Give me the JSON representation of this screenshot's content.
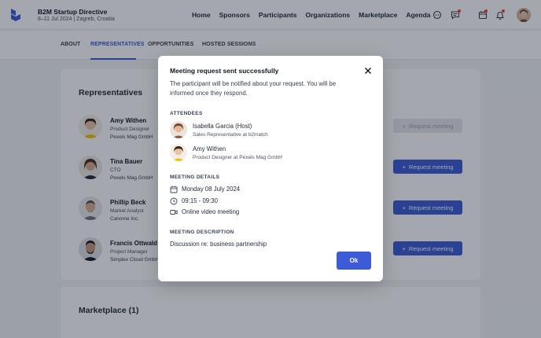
{
  "header": {
    "event_title": "B2M Startup Directive",
    "event_subtitle": "8–11 Jul 2024 | Zagreb, Croatia",
    "nav": [
      "Home",
      "Sponsors",
      "Participants",
      "Organizations",
      "Marketplace",
      "Agenda"
    ],
    "icons": [
      "chat-icon",
      "message-icon",
      "calendar-icon",
      "bell-icon"
    ],
    "accent": "#3c5bd6"
  },
  "tabs": [
    {
      "label": "ABOUT",
      "active": false
    },
    {
      "label": "REPRESENTATIVES",
      "active": true
    },
    {
      "label": "OPPORTUNITIES",
      "active": false
    },
    {
      "label": "HOSTED SESSIONS",
      "active": false
    }
  ],
  "representatives": {
    "title": "Representatives",
    "button_label": "Request meeting",
    "items": [
      {
        "name": "Amy Withen",
        "role": "Product Designer",
        "company": "Pexels Mag GmbH",
        "requested": true
      },
      {
        "name": "Tina Bauer",
        "role": "CTO",
        "company": "Pexels Mag GmbH",
        "requested": false
      },
      {
        "name": "Phillip Beck",
        "role": "Market Analyst",
        "company": "Canome Inc.",
        "requested": false
      },
      {
        "name": "Francis Ottwald",
        "role": "Project Manager",
        "company": "Simplex Cloud GmbH",
        "requested": false
      }
    ]
  },
  "marketplace": {
    "title": "Marketplace (1)"
  },
  "modal": {
    "title": "Meeting request sent successfully",
    "description": "The participant will be notified about your request. You will be informed once they respond.",
    "attendees_label": "ATTENDEES",
    "attendees": [
      {
        "name": "Isabella Garcia (Host)",
        "role": "Sales Representative at b2match"
      },
      {
        "name": "Amy Withen",
        "role": "Product Designer at Pexels Mag GmbH"
      }
    ],
    "details_label": "MEETING DETAILS",
    "date": "Monday 08 July 2024",
    "time": "09:15 - 09:30",
    "location": "Online video meeting",
    "description_label": "MEETING DESCRIPTION",
    "meeting_description": "Discussion re: business partnership",
    "ok_label": "Ok"
  }
}
